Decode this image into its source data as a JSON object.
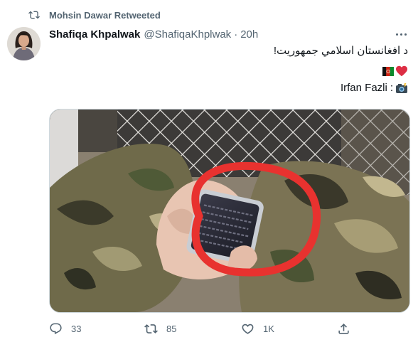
{
  "retweet": {
    "icon": "retweet-icon",
    "text": "Mohsin Dawar Retweeted"
  },
  "author": {
    "name": "Shafiqa Khpalwak",
    "handle": "@ShafiqaKhplwak",
    "separator": "·",
    "time": "20h"
  },
  "tweet": {
    "text": "د افغانستان اسلامي جمهوریت!",
    "emojis": [
      "afghanistan-flag",
      "red-heart"
    ],
    "credit_prefix": "Irfan Fazli",
    "credit_suffix": ":",
    "credit_emoji": "camera-with-flash"
  },
  "media": {
    "alt_subject": "soldier-hands-holding-phone-circled-red"
  },
  "actions": {
    "reply": {
      "icon": "reply-icon",
      "count": "33"
    },
    "retweet": {
      "icon": "retweet-icon",
      "count": "85"
    },
    "like": {
      "icon": "heart-icon",
      "count": "1K"
    },
    "share": {
      "icon": "share-icon"
    }
  },
  "colors": {
    "text": "#0f1419",
    "secondary": "#536471",
    "border": "#cfd9de",
    "circle": "#e8322f"
  }
}
